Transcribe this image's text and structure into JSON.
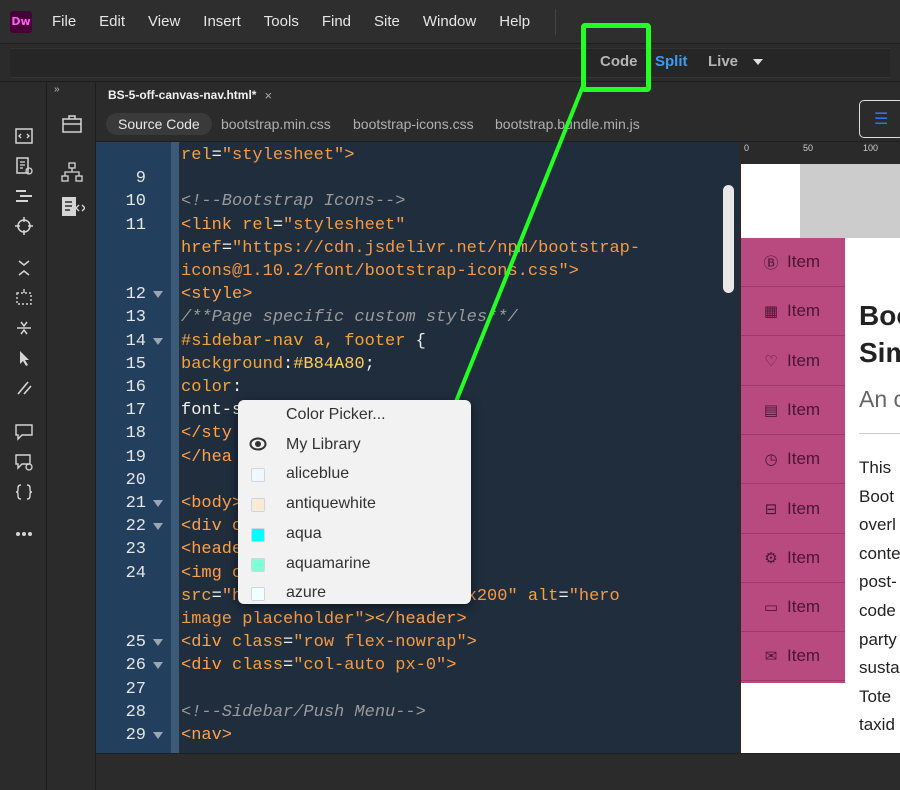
{
  "app": {
    "logo": "Dw",
    "menu": [
      "File",
      "Edit",
      "View",
      "Insert",
      "Tools",
      "Find",
      "Site",
      "Window",
      "Help"
    ]
  },
  "view_modes": {
    "code": "Code",
    "split": "Split",
    "live": "Live"
  },
  "document": {
    "tab_title": "BS-5-off-canvas-nav.html*",
    "close": "×",
    "related_files": [
      "Source Code",
      "bootstrap.min.css",
      "bootstrap-icons.css",
      "bootstrap.bundle.min.js"
    ]
  },
  "code_lines": [
    {
      "num": "",
      "fold": false,
      "parts": [
        [
          "t-attr",
          "rel"
        ],
        [
          "t-txt",
          "="
        ],
        [
          "t-str",
          "\"stylesheet\""
        ],
        [
          "t-tag",
          ">"
        ]
      ]
    },
    {
      "num": "9",
      "fold": false,
      "parts": []
    },
    {
      "num": "10",
      "fold": false,
      "parts": [
        [
          "t-com",
          "<!--Bootstrap Icons-->"
        ]
      ]
    },
    {
      "num": "11",
      "fold": false,
      "parts": [
        [
          "t-tag",
          "<link "
        ],
        [
          "t-attr",
          "rel"
        ],
        [
          "t-txt",
          "="
        ],
        [
          "t-str",
          "\"stylesheet\""
        ]
      ]
    },
    {
      "num": "",
      "fold": false,
      "parts": [
        [
          "t-attr",
          "href"
        ],
        [
          "t-txt",
          "="
        ],
        [
          "t-str",
          "\"https://cdn.jsdelivr.net/npm/bootstrap-"
        ]
      ]
    },
    {
      "num": "",
      "fold": false,
      "parts": [
        [
          "t-str",
          "icons@1.10.2/font/bootstrap-icons.css\""
        ],
        [
          "t-tag",
          ">"
        ]
      ]
    },
    {
      "num": "12",
      "fold": true,
      "parts": [
        [
          "t-tag",
          "<style>"
        ]
      ]
    },
    {
      "num": "13",
      "fold": false,
      "parts": [
        [
          "t-com",
          "/**Page specific custom styles**/"
        ]
      ]
    },
    {
      "num": "14",
      "fold": true,
      "parts": [
        [
          "t-sel",
          "#sidebar-nav a, footer "
        ],
        [
          "t-txt",
          "{"
        ]
      ]
    },
    {
      "num": "15",
      "fold": false,
      "parts": [
        [
          "t-sel",
          "background"
        ],
        [
          "t-txt",
          ":"
        ],
        [
          "t-num",
          "#B84A80"
        ],
        [
          "t-txt",
          ";"
        ]
      ]
    },
    {
      "num": "16",
      "fold": false,
      "parts": [
        [
          "t-sel",
          "color"
        ],
        [
          "t-txt",
          ":"
        ]
      ]
    },
    {
      "num": "17",
      "fold": false,
      "parts": [
        [
          "t-txt",
          "font-s"
        ]
      ]
    },
    {
      "num": "18",
      "fold": false,
      "parts": [
        [
          "t-tag",
          "</sty"
        ]
      ]
    },
    {
      "num": "19",
      "fold": false,
      "parts": [
        [
          "t-tag",
          "</hea"
        ]
      ]
    },
    {
      "num": "20",
      "fold": false,
      "parts": []
    },
    {
      "num": "21",
      "fold": true,
      "parts": [
        [
          "t-tag",
          "<body>"
        ]
      ]
    },
    {
      "num": "22",
      "fold": true,
      "parts": [
        [
          "t-tag",
          "<div "
        ],
        [
          "t-attr",
          "c"
        ],
        [
          "t-txt",
          "                  "
        ],
        [
          "t-str",
          "\""
        ],
        [
          "t-tag",
          ">"
        ]
      ]
    },
    {
      "num": "23",
      "fold": false,
      "parts": [
        [
          "t-tag",
          "<heade"
        ],
        [
          "t-txt",
          "                 "
        ],
        [
          "t-str",
          "to\""
        ],
        [
          "t-tag",
          ">"
        ]
      ]
    },
    {
      "num": "24",
      "fold": false,
      "parts": [
        [
          "t-tag",
          "<img "
        ],
        [
          "t-attr",
          "c"
        ]
      ]
    },
    {
      "num": "",
      "fold": false,
      "parts": [
        [
          "t-attr",
          "src"
        ],
        [
          "t-txt",
          "="
        ],
        [
          "t-str",
          "\"h                 /1200x200\" "
        ],
        [
          "t-attr",
          "alt"
        ],
        [
          "t-txt",
          "="
        ],
        [
          "t-str",
          "\"hero"
        ]
      ]
    },
    {
      "num": "",
      "fold": false,
      "parts": [
        [
          "t-str",
          "image placeholder\""
        ],
        [
          "t-tag",
          "></header>"
        ]
      ]
    },
    {
      "num": "25",
      "fold": true,
      "parts": [
        [
          "t-tag",
          "<div "
        ],
        [
          "t-attr",
          "class"
        ],
        [
          "t-txt",
          "="
        ],
        [
          "t-str",
          "\"row flex-nowrap\""
        ],
        [
          "t-tag",
          ">"
        ]
      ]
    },
    {
      "num": "26",
      "fold": true,
      "parts": [
        [
          "t-tag",
          "<div "
        ],
        [
          "t-attr",
          "class"
        ],
        [
          "t-txt",
          "="
        ],
        [
          "t-str",
          "\"col-auto px-0\""
        ],
        [
          "t-tag",
          ">"
        ]
      ]
    },
    {
      "num": "27",
      "fold": false,
      "parts": []
    },
    {
      "num": "28",
      "fold": false,
      "parts": [
        [
          "t-com",
          "<!--Sidebar/Push Menu-->"
        ]
      ]
    },
    {
      "num": "29",
      "fold": true,
      "parts": [
        [
          "t-tag",
          "<nav>"
        ]
      ]
    }
  ],
  "color_picker": {
    "items": [
      {
        "label": "Color Picker...",
        "swatch": null,
        "icon": null
      },
      {
        "label": "My Library",
        "swatch": null,
        "icon": "cc-library-icon"
      },
      {
        "label": "aliceblue",
        "swatch": "#f0f8ff",
        "icon": null
      },
      {
        "label": "antiquewhite",
        "swatch": "#faebd7",
        "icon": null
      },
      {
        "label": "aqua",
        "swatch": "#00ffff",
        "icon": null
      },
      {
        "label": "aquamarine",
        "swatch": "#7fffd4",
        "icon": null
      },
      {
        "label": "azure",
        "swatch": "#f0ffff",
        "icon": null
      }
    ]
  },
  "preview": {
    "ruler": [
      "0",
      "50",
      "100"
    ],
    "nav_items": [
      {
        "icon": "bootstrap-icon",
        "glyph": "Ⓑ",
        "label": "Item"
      },
      {
        "icon": "film-icon",
        "glyph": "▦",
        "label": "Item"
      },
      {
        "icon": "heart-icon",
        "glyph": "♡",
        "label": "Item"
      },
      {
        "icon": "bricks-icon",
        "glyph": "▤",
        "label": "Item"
      },
      {
        "icon": "clock-icon",
        "glyph": "◷",
        "label": "Item"
      },
      {
        "icon": "archive-icon",
        "glyph": "⊟",
        "label": "Item"
      },
      {
        "icon": "gear-icon",
        "glyph": "⚙",
        "label": "Item"
      },
      {
        "icon": "calendar-icon",
        "glyph": "▭",
        "label": "Item"
      },
      {
        "icon": "envelope-icon",
        "glyph": "✉",
        "label": "Item"
      }
    ],
    "menu_glyph": "☰",
    "heading1": "Boo",
    "heading2": "Sim",
    "subheading": "An c",
    "paragraph": [
      "This",
      "Boot",
      "overl",
      "conte",
      "post-",
      "code",
      "party",
      "susta",
      "Tote",
      "taxid"
    ],
    "nav_color": "#B84A80"
  },
  "colors": {
    "highlight": "#22ff22",
    "split_active": "#3b9cf2"
  }
}
